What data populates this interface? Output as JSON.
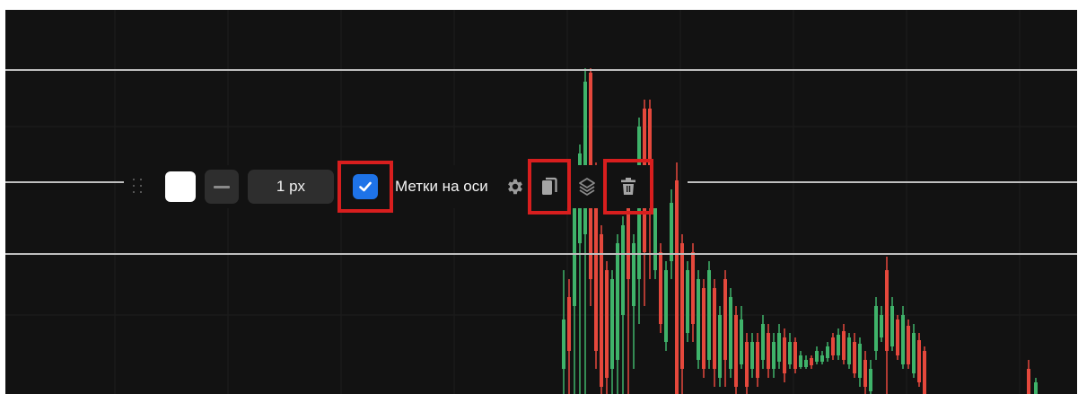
{
  "toolbar": {
    "line_color": "#ffffff",
    "line_width_label": "1 px",
    "axis_labels": {
      "checked": true,
      "label": "Метки на оси"
    }
  },
  "colors": {
    "background": "#121212",
    "level_line": "#bfbfbf",
    "bull": "#3fb36a",
    "bear": "#e5483c",
    "accent": "#1e73e8",
    "highlight": "#d81e1e"
  },
  "icons": [
    "drag-handle-icon",
    "line-style-icon",
    "checkmark-icon",
    "gear-icon",
    "copy-icon",
    "layers-icon",
    "trash-icon"
  ]
}
